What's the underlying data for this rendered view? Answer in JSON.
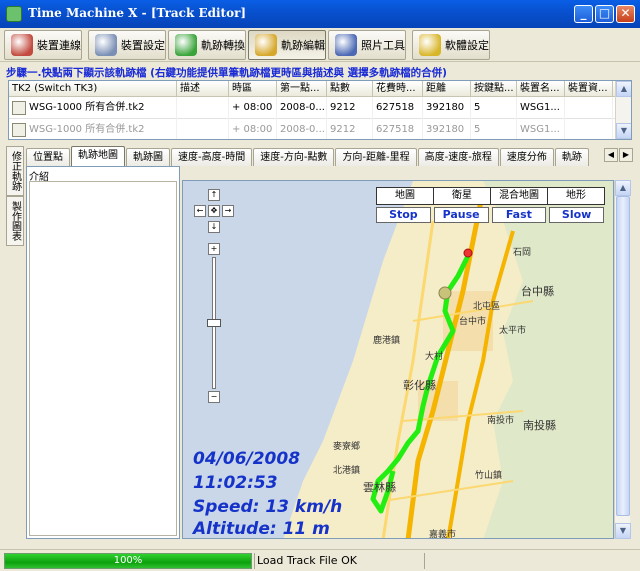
{
  "window": {
    "title": "Time Machine X - [Track Editor]",
    "min": "_",
    "max": "□",
    "close": "✕"
  },
  "toolbar": [
    {
      "label": "裝置連線",
      "icon": "device-connect-icon",
      "color": "#c24a3e"
    },
    {
      "label": "裝置設定",
      "icon": "device-settings-icon",
      "color": "#7a8fb5"
    },
    {
      "label": "軌跡轉換",
      "icon": "track-convert-icon",
      "color": "#3aa43a"
    },
    {
      "label": "軌跡編輯",
      "icon": "track-edit-icon",
      "color": "#d6a72a"
    },
    {
      "label": "照片工具",
      "icon": "photo-tool-icon",
      "color": "#4a68b4"
    },
    {
      "label": "軟體設定",
      "icon": "software-settings-icon",
      "color": "#d8b62a"
    }
  ],
  "step_text": "步驟一.快點兩下顯示該軌跡檔 (右鍵功能提供單筆軌跡檔更時區與描述與 選擇多軌跡檔的合併)",
  "table": {
    "columns": [
      "TK2 (Switch TK3)",
      "描述",
      "時區",
      "第一點...",
      "點數",
      "花費時...",
      "距離",
      "按鍵點...",
      "裝置名...",
      "裝置資..."
    ],
    "rows": [
      [
        "WSG-1000 所有合併.tk2",
        "",
        "+ 08:00",
        "2008-0...",
        "9212",
        "627518",
        "392180",
        "5",
        "WSG1...",
        ""
      ],
      [
        "WSG-1000 所有合併.tk2",
        "",
        "+ 08:00",
        "2008-0...",
        "9212",
        "627518",
        "392180",
        "5",
        "WSG1...",
        ""
      ]
    ]
  },
  "side_tabs": [
    "修正軌跡",
    "製作圖表"
  ],
  "tabs": [
    "位置點",
    "軌跡地圖",
    "軌跡圖",
    "速度-高度-時間",
    "速度-方向-點數",
    "方向-距離-里程",
    "高度-速度-旅程",
    "速度分佈",
    "軌跡"
  ],
  "active_tab": "軌跡地圖",
  "left_panel_label": "介紹",
  "map": {
    "types": [
      "地圖",
      "衛星",
      "混合地圖",
      "地形"
    ],
    "controls": [
      "Stop",
      "Pause",
      "Fast",
      "Slow"
    ],
    "labels": [
      "台中縣",
      "台中市",
      "太平市",
      "北屯區",
      "彰化縣",
      "南投市",
      "南投縣",
      "雲林縣",
      "竹山鎮",
      "嘉義市",
      "鹿港鎮",
      "麥寮鄉",
      "北港鎮",
      "大村",
      "石岡"
    ],
    "route_color": "#22ee11",
    "overlay": {
      "date": "04/06/2008",
      "time": "11:02:53",
      "speed": "Speed: 13 km/h",
      "altitude": "Altitude: 11 m"
    }
  },
  "status": {
    "progress": "100%",
    "progress_value": 1.0,
    "message": "Load Track File OK"
  }
}
